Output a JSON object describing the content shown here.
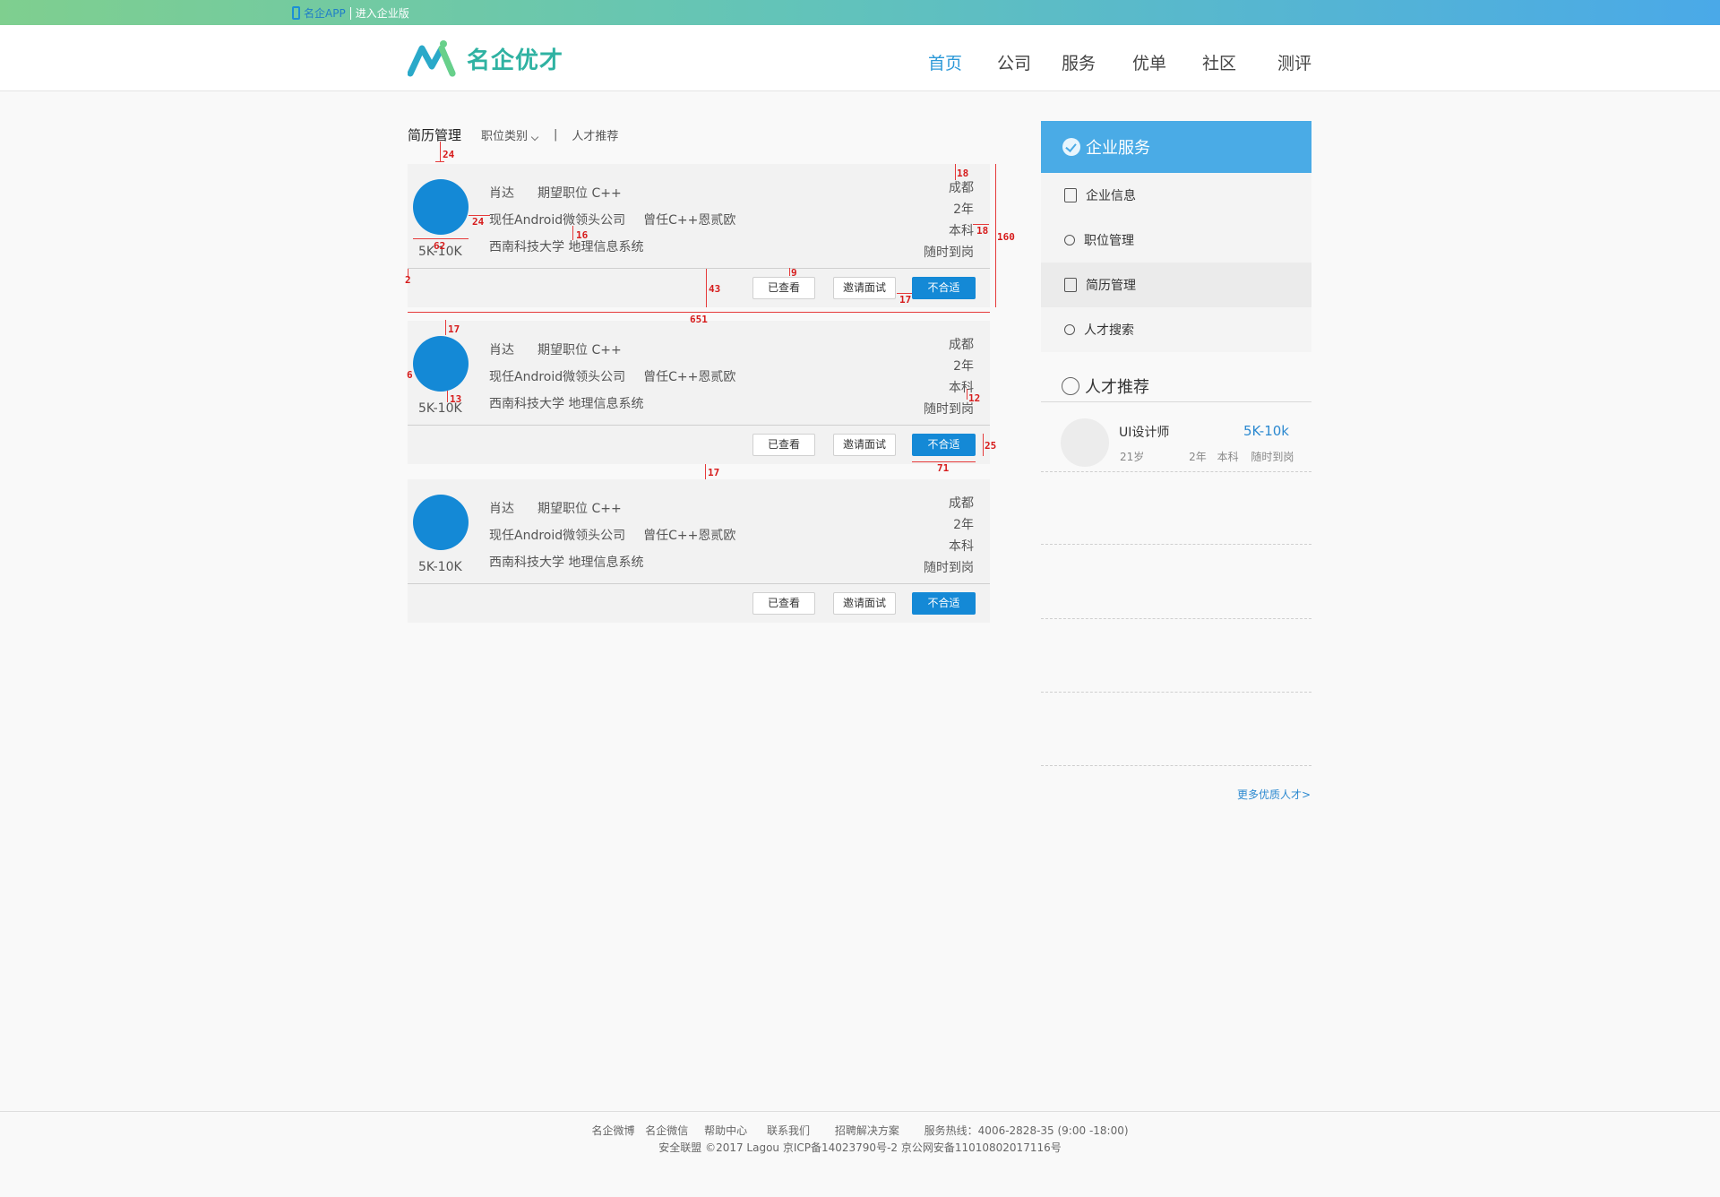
{
  "topbar": {
    "app_link": "名企APP",
    "enterprise_link": "进入企业版"
  },
  "header": {
    "logo_text": "名企优才",
    "nav": [
      "首页",
      "公司",
      "服务",
      "优单",
      "社区",
      "测评"
    ]
  },
  "tabs": {
    "main": "简历管理",
    "category": "职位类别",
    "divider": "|",
    "recommend": "人才推荐"
  },
  "cards": [
    {
      "name": "肖达",
      "expected": "期望职位 C++",
      "current": "现任Android微领头公司",
      "previous": "曾任C++恩贰欧",
      "school": "西南科技大学 地理信息系统",
      "salary": "5K-10K",
      "city": "成都",
      "years": "2年",
      "degree": "本科",
      "availability": "随时到岗",
      "btn_viewed": "已查看",
      "btn_invite": "邀请面试",
      "btn_reject": "不合适"
    },
    {
      "name": "肖达",
      "expected": "期望职位 C++",
      "current": "现任Android微领头公司",
      "previous": "曾任C++恩贰欧",
      "school": "西南科技大学 地理信息系统",
      "salary": "5K-10K",
      "city": "成都",
      "years": "2年",
      "degree": "本科",
      "availability": "随时到岗",
      "btn_viewed": "已查看",
      "btn_invite": "邀请面试",
      "btn_reject": "不合适"
    },
    {
      "name": "肖达",
      "expected": "期望职位 C++",
      "current": "现任Android微领头公司",
      "previous": "曾任C++恩贰欧",
      "school": "西南科技大学 地理信息系统",
      "salary": "5K-10K",
      "city": "成都",
      "years": "2年",
      "degree": "本科",
      "availability": "随时到岗",
      "btn_viewed": "已查看",
      "btn_invite": "邀请面试",
      "btn_reject": "不合适"
    }
  ],
  "annotations": [
    "24",
    "18",
    "24",
    "16",
    "62",
    "18",
    "160",
    "2",
    "9",
    "43",
    "17",
    "651",
    "17",
    "6",
    "13",
    "12",
    "25",
    "17",
    "71"
  ],
  "sidebar": {
    "title": "企业服务",
    "items": [
      "企业信息",
      "职位管理",
      "简历管理",
      "人才搜索"
    ],
    "recommend_title": "人才推荐",
    "recommend": {
      "role": "UI设计师",
      "salary": "5K-10k",
      "age": "21岁",
      "years": "2年",
      "degree": "本科",
      "availability": "随时到岗"
    },
    "more": "更多优质人才>"
  },
  "footer": {
    "links": [
      "名企微博",
      "名企微信",
      "帮助中心",
      "联系我们",
      "招聘解决方案",
      "服务热线：4006-2828-35 (9:00 -18:00)"
    ],
    "line2": "安全联盟  ©2017 Lagou 京ICP备14023790号-2 京公网安备11010802017116号"
  },
  "colors": {
    "accent": "#1489d6",
    "sidebar_head": "#4aabe6",
    "nav_active": "#2c99d8",
    "annotation": "#d61b1b"
  }
}
